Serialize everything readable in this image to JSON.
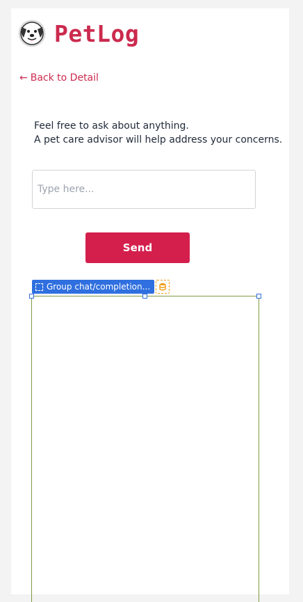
{
  "brand": {
    "name": "PetLog",
    "icon": "dog-face-icon",
    "color": "#cc2a4e"
  },
  "nav": {
    "back_arrow": "←",
    "back_label": "Back to Detail"
  },
  "intro": {
    "line1": "Feel free to ask about anything.",
    "line2": "A pet care advisor will help address your concerns."
  },
  "input": {
    "placeholder": "Type here...",
    "value": ""
  },
  "send": {
    "label": "Send",
    "color": "#d41f4d"
  },
  "editor": {
    "group_label": "Group chat/completion...",
    "group_tag_color": "#2f6fdf",
    "data_icon": "database-icon",
    "data_icon_color": "#f39c12"
  }
}
